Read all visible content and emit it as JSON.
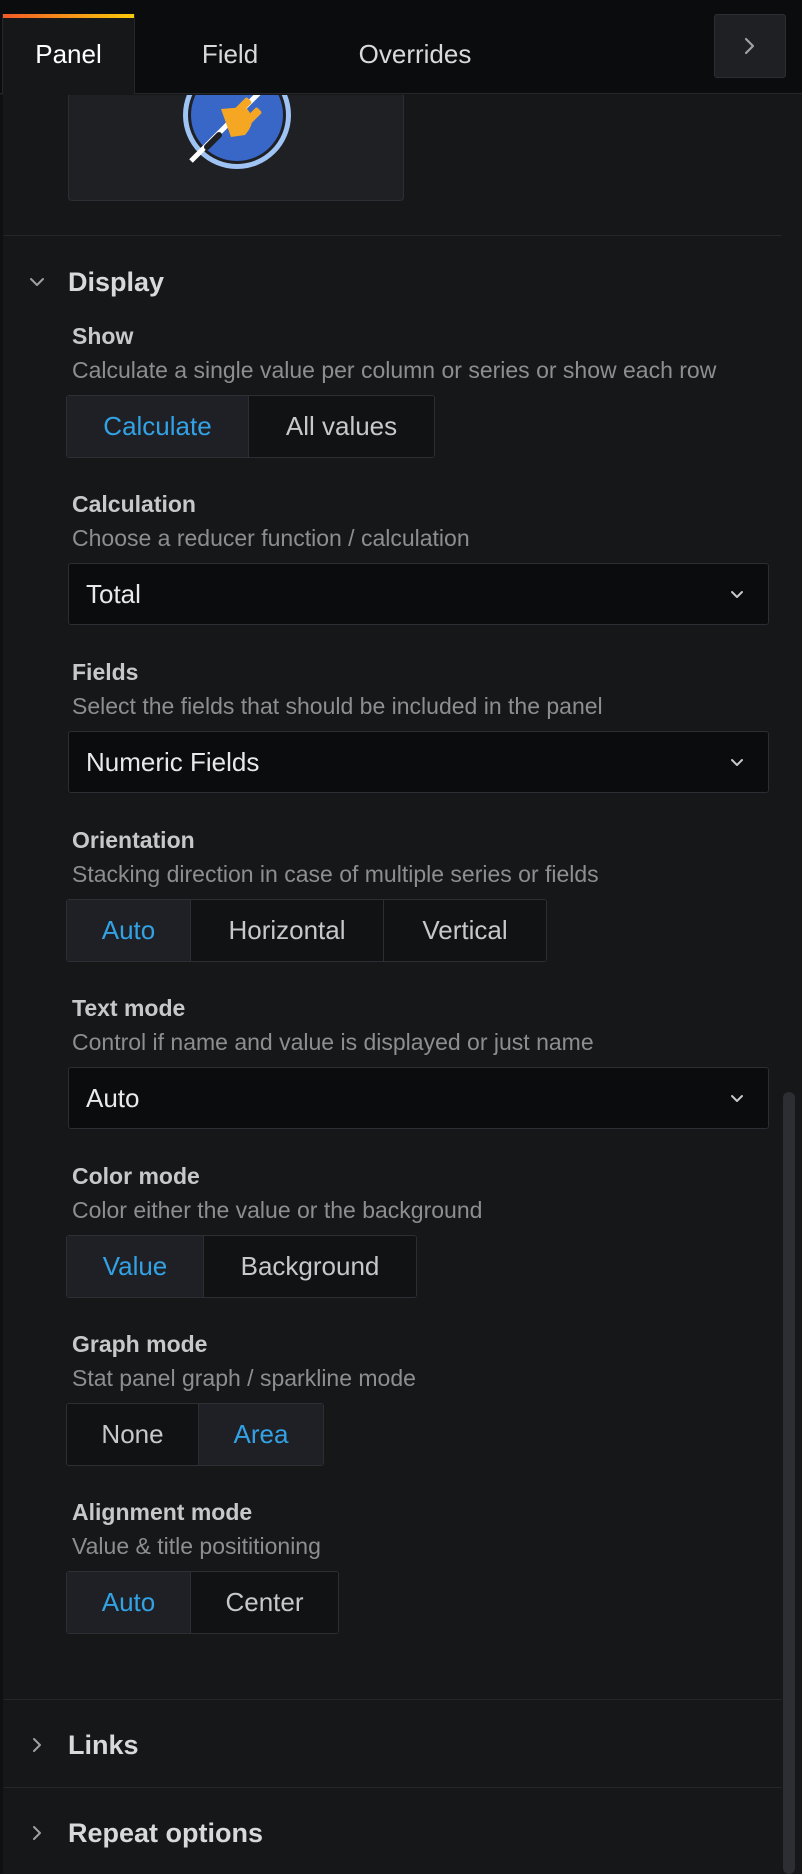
{
  "tabs": [
    {
      "label": "Panel",
      "active": true
    },
    {
      "label": "Field",
      "active": false
    },
    {
      "label": "Overrides",
      "active": false
    }
  ],
  "collapse_icon": "chevron-right-icon",
  "logo_icon": "plug-icon",
  "colors": {
    "background": "#161719",
    "selected_text": "#33a2e5",
    "accent_gradient": [
      "#f05a28",
      "#fbca0a"
    ],
    "logo_blue": "#3867c8",
    "logo_orange": "#f5a623"
  },
  "display": {
    "title": "Display",
    "expanded": true,
    "show": {
      "label": "Show",
      "description": "Calculate a single value per column or series or show each row",
      "options": [
        "Calculate",
        "All values"
      ],
      "selected": "Calculate"
    },
    "calculation": {
      "label": "Calculation",
      "description": "Choose a reducer function / calculation",
      "value": "Total"
    },
    "fields": {
      "label": "Fields",
      "description": "Select the fields that should be included in the panel",
      "value": "Numeric Fields"
    },
    "orientation": {
      "label": "Orientation",
      "description": "Stacking direction in case of multiple series or fields",
      "options": [
        "Auto",
        "Horizontal",
        "Vertical"
      ],
      "selected": "Auto"
    },
    "text_mode": {
      "label": "Text mode",
      "description": "Control if name and value is displayed or just name",
      "value": "Auto"
    },
    "color_mode": {
      "label": "Color mode",
      "description": "Color either the value or the background",
      "options": [
        "Value",
        "Background"
      ],
      "selected": "Value"
    },
    "graph_mode": {
      "label": "Graph mode",
      "description": "Stat panel graph / sparkline mode",
      "options": [
        "None",
        "Area"
      ],
      "selected": "Area"
    },
    "alignment_mode": {
      "label": "Alignment mode",
      "description": "Value & title posititioning",
      "options": [
        "Auto",
        "Center"
      ],
      "selected": "Auto"
    }
  },
  "links": {
    "title": "Links",
    "expanded": false
  },
  "repeat_options": {
    "title": "Repeat options",
    "expanded": false
  }
}
